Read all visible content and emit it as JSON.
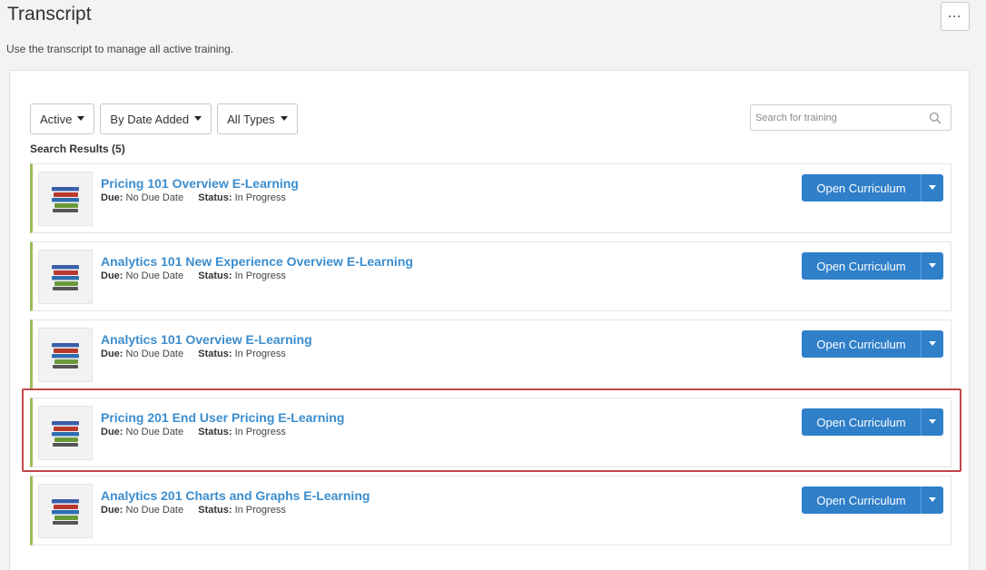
{
  "header": {
    "title": "Transcript",
    "subtitle": "Use the transcript to manage all active training.",
    "more_label": "···"
  },
  "filters": {
    "status": "Active",
    "sort": "By Date Added",
    "type": "All Types"
  },
  "search": {
    "placeholder": "Search for training",
    "value": ""
  },
  "results": {
    "label": "Search Results (5)"
  },
  "meta_labels": {
    "due": "Due:",
    "status": "Status:"
  },
  "items": [
    {
      "title": "Pricing 101 Overview E-Learning",
      "due": "No Due Date",
      "status": "In Progress",
      "action": "Open Curriculum",
      "highlighted": false
    },
    {
      "title": "Analytics 101 New Experience Overview E-Learning",
      "due": "No Due Date",
      "status": "In Progress",
      "action": "Open Curriculum",
      "highlighted": false
    },
    {
      "title": "Analytics 101 Overview E-Learning",
      "due": "No Due Date",
      "status": "In Progress",
      "action": "Open Curriculum",
      "highlighted": false
    },
    {
      "title": "Pricing 201 End User Pricing E-Learning",
      "due": "No Due Date",
      "status": "In Progress",
      "action": "Open Curriculum",
      "highlighted": true
    },
    {
      "title": "Analytics 201 Charts and Graphs E-Learning",
      "due": "No Due Date",
      "status": "In Progress",
      "action": "Open Curriculum",
      "highlighted": false
    }
  ],
  "colors": {
    "accent": "#2f7fc9",
    "title_link": "#3b8dce",
    "card_border_left": "#9bbb59",
    "highlight_border": "#c0474a"
  },
  "icons": {
    "item_thumbnail": "books-stack-icon",
    "search": "search-icon",
    "more": "more-icon"
  }
}
